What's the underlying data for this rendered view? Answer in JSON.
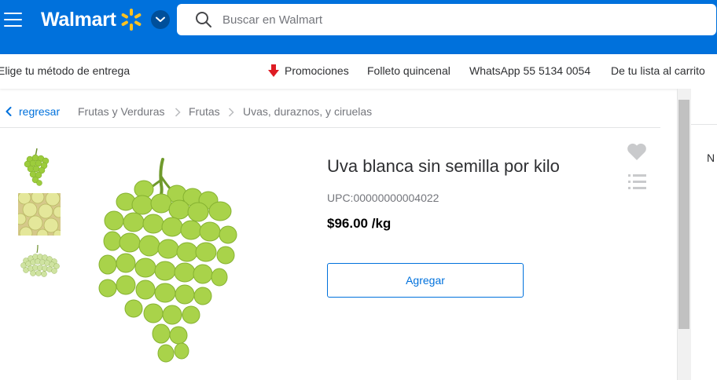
{
  "header": {
    "logo_text": "Walmart",
    "brand_color": "#0071dc",
    "spark_color": "#ffc220",
    "search": {
      "placeholder": "Buscar en Walmart",
      "value": ""
    }
  },
  "subnav": {
    "delivery": "Elige tu método de entrega",
    "promociones": "Promociones",
    "folleto": "Folleto quincenal",
    "whatsapp": "WhatsApp 55 5134 0054",
    "lista": "De tu lista al carrito"
  },
  "breadcrumb": {
    "back": "regresar",
    "items": [
      "Frutas y Verduras",
      "Frutas",
      "Uvas, duraznos, y ciruelas"
    ]
  },
  "product": {
    "title": "Uva blanca sin semilla por kilo",
    "upc": "UPC:00000000004022",
    "price": "$96.00 /kg",
    "add_button": "Agregar",
    "thumbnail_count": 3
  },
  "right_panel": {
    "partial_text": "N"
  },
  "icons": [
    "menu-icon",
    "walmart-spark-icon",
    "chevron-down-icon",
    "search-icon",
    "promo-arrow-icon",
    "chevron-left-icon",
    "chevron-right-icon",
    "heart-icon",
    "list-icon"
  ]
}
